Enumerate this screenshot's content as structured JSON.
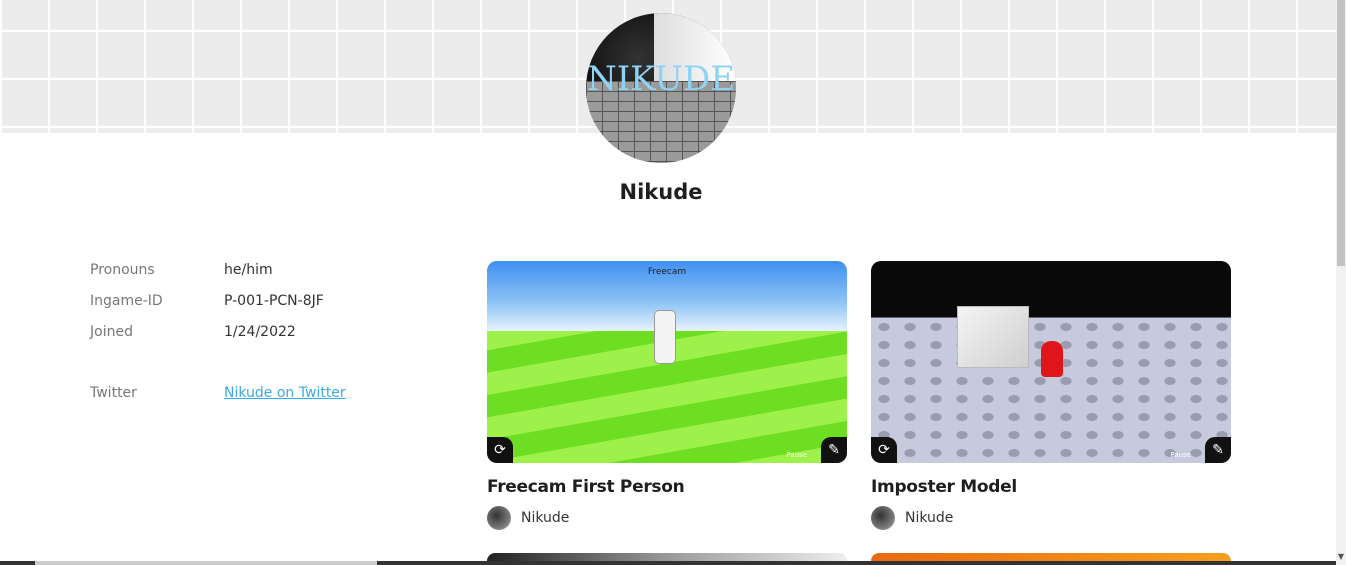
{
  "profile": {
    "avatar_text": "NIKUDE",
    "name": "Nikude"
  },
  "info": {
    "pronouns_label": "Pronouns",
    "pronouns_value": "he/him",
    "ingame_label": "Ingame-ID",
    "ingame_value": "P-001-PCN-8JF",
    "joined_label": "Joined",
    "joined_value": "1/24/2022",
    "twitter_label": "Twitter",
    "twitter_link": "Nikude on Twitter"
  },
  "cards": [
    {
      "title": "Freecam First Person",
      "author": "Nikude",
      "overlay_title": "Freecam",
      "pause_label": "Pause"
    },
    {
      "title": "Imposter Model",
      "author": "Nikude",
      "pause_label": "Pause"
    }
  ],
  "colors": {
    "link": "#3da9e4",
    "banner": "#ececec"
  }
}
